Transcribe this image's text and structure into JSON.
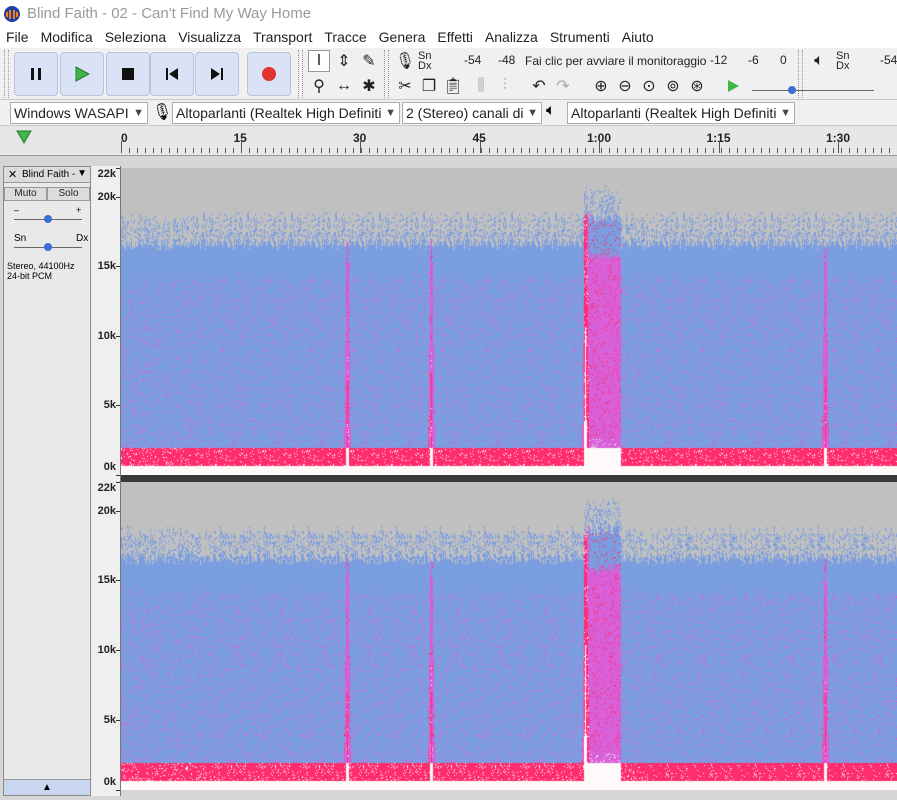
{
  "window": {
    "title": "Blind Faith - 02 - Can't Find My Way Home"
  },
  "menu": [
    "File",
    "Modifica",
    "Seleziona",
    "Visualizza",
    "Transport",
    "Tracce",
    "Genera",
    "Effetti",
    "Analizza",
    "Strumenti",
    "Aiuto"
  ],
  "transport": {
    "pause": "pause-icon",
    "play": "play-icon",
    "stop": "stop-icon",
    "skip_start": "skip-start-icon",
    "skip_end": "skip-end-icon",
    "record": "record-icon"
  },
  "meters": {
    "rec_channels": "Sn\nDx",
    "rec_values": [
      "-54",
      "-48"
    ],
    "rec_prompt": "Fai clic per avviare il monitoraggio",
    "rec_values2": [
      "-12",
      "-6",
      "0"
    ],
    "play_channels": "Sn\nDx",
    "play_value": "-54"
  },
  "device": {
    "host": "Windows WASAPI",
    "input": "Altoparlanti (Realtek High Definiti",
    "channels": "2 (Stereo) canali di",
    "output": "Altoparlanti (Realtek High Definiti"
  },
  "timeline": {
    "ticks": [
      "0",
      "15",
      "30",
      "45",
      "1:00",
      "1:15",
      "1:30"
    ]
  },
  "track": {
    "name": "Blind Faith -",
    "mute": "Muto",
    "solo": "Solo",
    "gain_minus": "–",
    "gain_plus": "+",
    "pan_left": "Sn",
    "pan_right": "Dx",
    "info_line1": "Stereo, 44100Hz",
    "info_line2": "24-bit PCM",
    "freq_labels": [
      "22k",
      "20k",
      "15k",
      "10k",
      "5k",
      "0k"
    ]
  },
  "colors": {
    "spectrum_bg": "#c0c0c0",
    "spectrum_low": "#7b9ee0",
    "spectrum_mid": "#d860d8",
    "spectrum_high": "#ff2c6e",
    "accent_play": "#3fb54a",
    "accent_record": "#e0322e"
  }
}
